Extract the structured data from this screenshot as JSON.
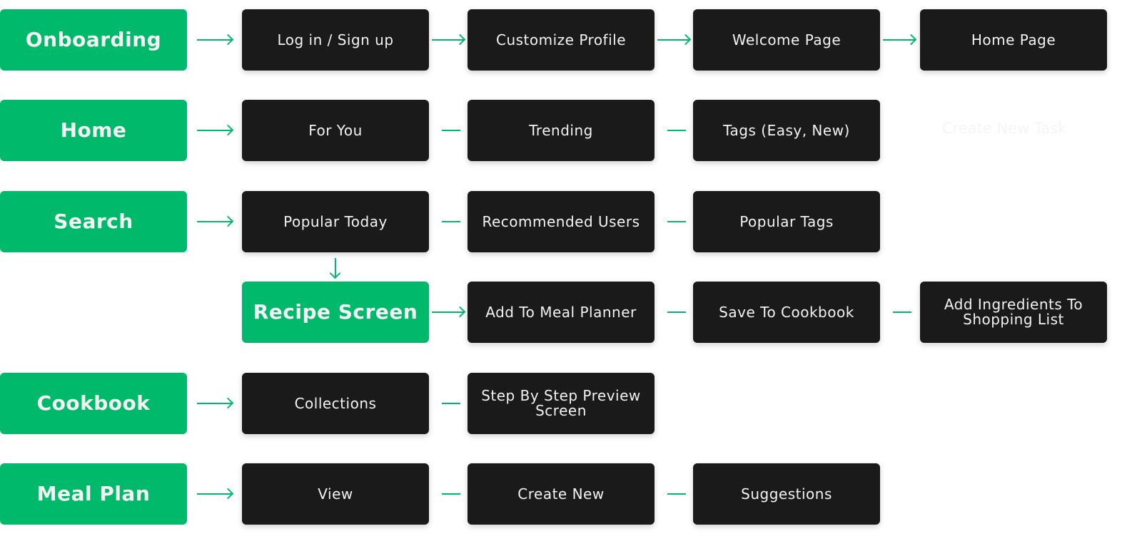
{
  "colors": {
    "accent": "#00b96b",
    "node": "#1a1a1a",
    "text": "#f2f2f2"
  },
  "rows": [
    {
      "lead": "Onboarding",
      "connector": "arrow",
      "nodes": [
        {
          "label": "Log in / Sign up",
          "style": "dark"
        },
        {
          "label": "Customize Profile",
          "style": "dark"
        },
        {
          "label": "Welcome Page",
          "style": "dark"
        },
        {
          "label": "Home Page",
          "style": "dark"
        }
      ]
    },
    {
      "lead": "Home",
      "connector": "line",
      "nodes": [
        {
          "label": "For You",
          "style": "dark"
        },
        {
          "label": "Trending",
          "style": "dark"
        },
        {
          "label": "Tags (Easy, New)",
          "style": "dark"
        }
      ]
    },
    {
      "lead": "Search",
      "connector": "line",
      "nodes": [
        {
          "label": "Popular Today",
          "style": "dark"
        },
        {
          "label": "Recommended Users",
          "style": "dark"
        },
        {
          "label": "Popular Tags",
          "style": "dark"
        }
      ]
    },
    {
      "lead": null,
      "connector": "line",
      "nodes": [
        {
          "label": "Recipe Screen",
          "style": "green"
        },
        {
          "label": "Add To Meal Planner",
          "style": "dark"
        },
        {
          "label": "Save To Cookbook",
          "style": "dark"
        },
        {
          "label": "Add Ingredients To Shopping List",
          "style": "dark"
        }
      ]
    },
    {
      "lead": "Cookbook",
      "connector": "line",
      "nodes": [
        {
          "label": "Collections",
          "style": "dark"
        },
        {
          "label": "Step By Step Preview Screen",
          "style": "dark"
        }
      ]
    },
    {
      "lead": "Meal Plan",
      "connector": "line",
      "nodes": [
        {
          "label": "View",
          "style": "dark"
        },
        {
          "label": "Create New",
          "style": "dark"
        },
        {
          "label": "Suggestions",
          "style": "dark"
        }
      ]
    }
  ],
  "ghost_text": "Create New Task"
}
